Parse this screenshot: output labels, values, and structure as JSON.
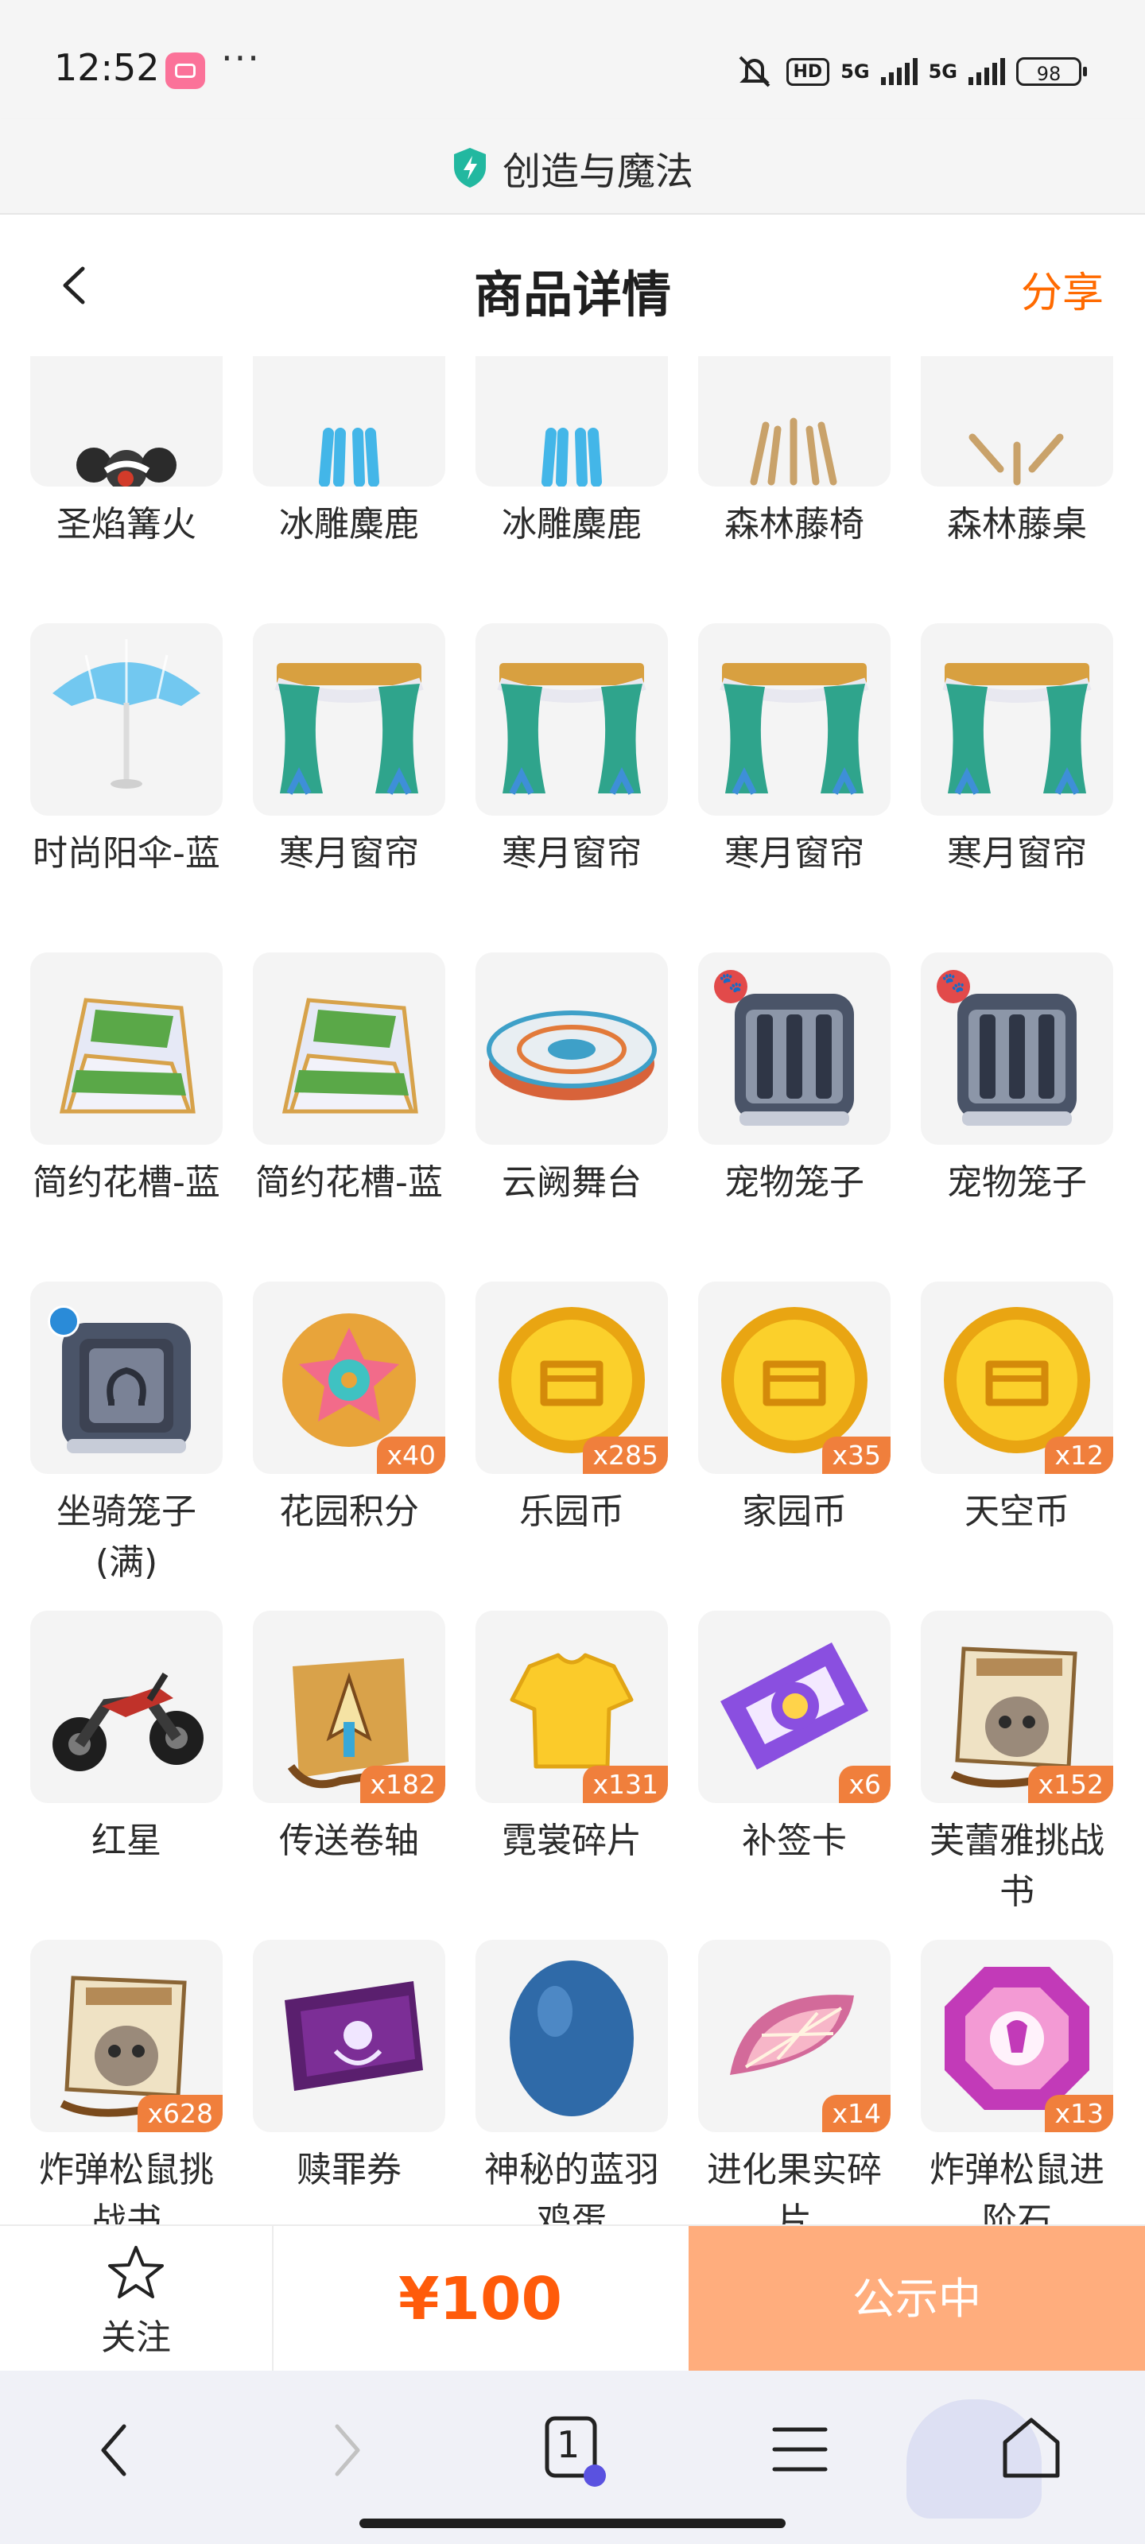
{
  "status_bar": {
    "time": "12:52",
    "more": "···",
    "hd": "HD",
    "network1": "5G",
    "network2": "5G",
    "battery": "98"
  },
  "site": {
    "title": "创造与魔法"
  },
  "header": {
    "title": "商品详情",
    "share": "分享"
  },
  "items": [
    {
      "name": "圣焰篝火",
      "icon": "bonfire-icon"
    },
    {
      "name": "冰雕麋鹿",
      "icon": "ice-deer-icon"
    },
    {
      "name": "冰雕麋鹿",
      "icon": "ice-deer-icon"
    },
    {
      "name": "森林藤椅",
      "icon": "rattan-chair-icon"
    },
    {
      "name": "森林藤桌",
      "icon": "rattan-table-icon"
    },
    {
      "name": "时尚阳伞-蓝",
      "icon": "umbrella-icon"
    },
    {
      "name": "寒月窗帘",
      "icon": "curtain-icon"
    },
    {
      "name": "寒月窗帘",
      "icon": "curtain-icon"
    },
    {
      "name": "寒月窗帘",
      "icon": "curtain-icon"
    },
    {
      "name": "寒月窗帘",
      "icon": "curtain-icon"
    },
    {
      "name": "简约花槽-蓝",
      "icon": "flower-trough-icon"
    },
    {
      "name": "简约花槽-蓝",
      "icon": "flower-trough-icon"
    },
    {
      "name": "云阙舞台",
      "icon": "stage-icon"
    },
    {
      "name": "宠物笼子",
      "icon": "pet-cage-icon"
    },
    {
      "name": "宠物笼子",
      "icon": "pet-cage-icon"
    },
    {
      "name": "坐骑笼子(满)",
      "icon": "mount-cage-icon"
    },
    {
      "name": "花园积分",
      "icon": "flower-badge-icon",
      "qty": "x40"
    },
    {
      "name": "乐园币",
      "icon": "gold-coin-icon",
      "qty": "x285"
    },
    {
      "name": "家园币",
      "icon": "gold-coin-icon",
      "qty": "x35"
    },
    {
      "name": "天空币",
      "icon": "gold-coin-icon",
      "qty": "x12"
    },
    {
      "name": "红星",
      "icon": "motorcycle-icon"
    },
    {
      "name": "传送卷轴",
      "icon": "scroll-icon",
      "qty": "x182"
    },
    {
      "name": "霓裳碎片",
      "icon": "shirt-icon",
      "qty": "x131"
    },
    {
      "name": "补签卡",
      "icon": "ticket-icon",
      "qty": "x6"
    },
    {
      "name": "芙蕾雅挑战书",
      "icon": "wanted-poster-icon",
      "qty": "x152"
    },
    {
      "name": "炸弹松鼠挑战书",
      "icon": "wanted-poster-icon",
      "qty": "x628"
    },
    {
      "name": "赎罪券",
      "icon": "purple-ticket-icon"
    },
    {
      "name": "神秘的蓝羽鸡蛋",
      "icon": "blue-egg-icon"
    },
    {
      "name": "进化果实碎片",
      "icon": "fruit-slice-icon",
      "qty": "x14"
    },
    {
      "name": "炸弹松鼠进阶石",
      "icon": "gem-icon",
      "qty": "x13"
    },
    {
      "name": "",
      "icon": "blue-crystal-icon"
    },
    {
      "name": "",
      "icon": "ornament-icon"
    },
    {
      "name": "",
      "icon": "orange-item-icon"
    },
    {
      "name": "",
      "icon": "wanted-poster-icon"
    },
    {
      "name": "",
      "icon": "pink-crystal-icon"
    }
  ],
  "action_bar": {
    "follow": "关注",
    "price": "¥100",
    "status": "公示中"
  },
  "browser_nav": {
    "tab_count": "1"
  }
}
